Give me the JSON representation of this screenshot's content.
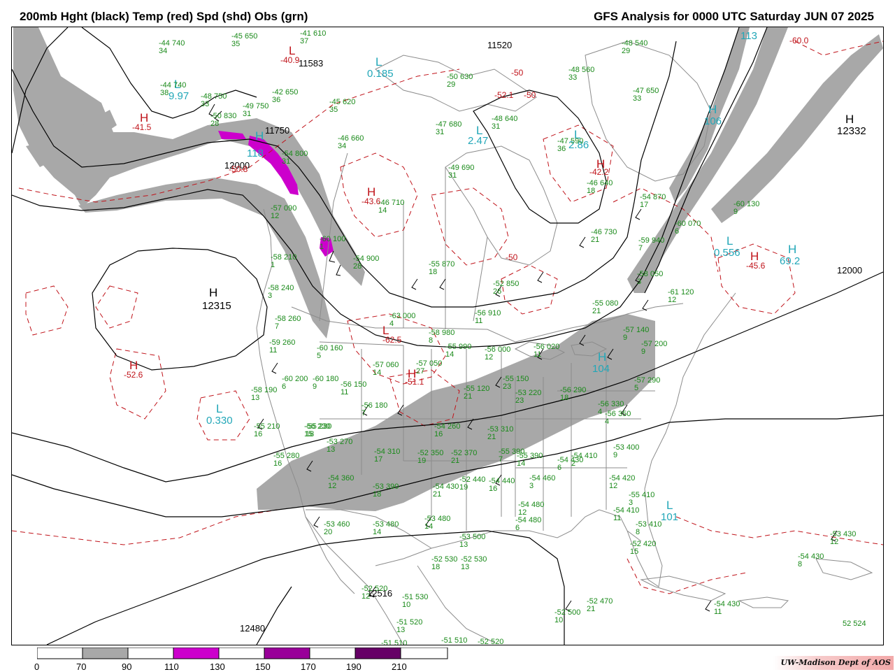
{
  "header": {
    "left_title": "200mb Hght (black) Temp (red) Spd (shd) Obs (grn)",
    "right_title": "GFS Analysis for 0000 UTC Saturday  JUN 07 2025"
  },
  "colors": {
    "height_contours": "#000000",
    "temperature_contours": "#c0131a",
    "speed_70_90": "#a8a8a8",
    "speed_110_130": "#cc00cc",
    "speed_150_170": "#990099",
    "speed_190_210": "#660066",
    "observations": "#1a8a1a",
    "low_high_speed_labels": "#22a7b8",
    "map_boundaries": "#8c8c8c"
  },
  "pressure_centers": [
    {
      "letter": "H",
      "value": "12315",
      "color": "black"
    },
    {
      "letter": "H",
      "value": "12332",
      "color": "black"
    },
    {
      "letter": "H",
      "value": "-41.5",
      "color": "red"
    },
    {
      "letter": "H",
      "value": "-43.6",
      "color": "red"
    },
    {
      "letter": "H",
      "value": "-42.2",
      "color": "red"
    },
    {
      "letter": "H",
      "value": "-52.6",
      "color": "red"
    },
    {
      "letter": "H",
      "value": "-51.1",
      "color": "red"
    },
    {
      "letter": "H",
      "value": "-45.6",
      "color": "red"
    },
    {
      "letter": "L",
      "value": "-62.5",
      "color": "red"
    },
    {
      "letter": "L",
      "value": "-40.9",
      "color": "red"
    },
    {
      "letter": "L",
      "value": "0.185",
      "color": "cyan"
    },
    {
      "letter": "L",
      "value": "2.47",
      "color": "cyan"
    },
    {
      "letter": "L",
      "value": "0.330",
      "color": "cyan"
    },
    {
      "letter": "L",
      "value": "0.556",
      "color": "cyan"
    },
    {
      "letter": "L",
      "value": "2.86",
      "color": "cyan"
    },
    {
      "letter": "L",
      "value": "9.97",
      "color": "cyan"
    },
    {
      "letter": "H",
      "value": "106",
      "color": "cyan"
    },
    {
      "letter": "H",
      "value": "69.2",
      "color": "cyan"
    },
    {
      "letter": "H",
      "value": "118",
      "color": "cyan"
    },
    {
      "letter": "H",
      "value": "104",
      "color": "cyan"
    },
    {
      "letter": "L",
      "value": "101",
      "color": "cyan"
    }
  ],
  "contour_labels": [
    "11520",
    "11583",
    "12000",
    "12000",
    "11750",
    "12516",
    "12480",
    "113",
    "-60.0",
    "-50",
    "-52.1",
    "-50",
    "-50",
    "-50.8"
  ],
  "observations": [
    {
      "top": "-44 740",
      "bottom": "34"
    },
    {
      "top": "-45 650",
      "bottom": "35"
    },
    {
      "top": "-41 610",
      "bottom": "37"
    },
    {
      "top": "-44 740",
      "bottom": "38"
    },
    {
      "top": "-48 750",
      "bottom": "33"
    },
    {
      "top": "-49 750",
      "bottom": "31"
    },
    {
      "top": "-50 830",
      "bottom": "28"
    },
    {
      "top": "-42 650",
      "bottom": "36"
    },
    {
      "top": "-45 620",
      "bottom": "35"
    },
    {
      "top": "-50 630",
      "bottom": "29"
    },
    {
      "top": "-48 560",
      "bottom": "33"
    },
    {
      "top": "-48 540",
      "bottom": "29"
    },
    {
      "top": "-47 650",
      "bottom": "33"
    },
    {
      "top": "-47 680",
      "bottom": "31"
    },
    {
      "top": "-48 640",
      "bottom": "31"
    },
    {
      "top": "-46 660",
      "bottom": "34"
    },
    {
      "top": "-47 590",
      "bottom": "36"
    },
    {
      "top": "-54 800",
      "bottom": "31"
    },
    {
      "top": "-49 690",
      "bottom": "31"
    },
    {
      "top": "-46 640",
      "bottom": "18"
    },
    {
      "top": "-46 710",
      "bottom": "14"
    },
    {
      "top": "-54 870",
      "bottom": "17"
    },
    {
      "top": "-60 130",
      "bottom": "9"
    },
    {
      "top": "-57 090",
      "bottom": "12"
    },
    {
      "top": "-60 070",
      "bottom": "6"
    },
    {
      "top": "-46 730",
      "bottom": "21"
    },
    {
      "top": "-60 100",
      "bottom": "1"
    },
    {
      "top": "-59 940",
      "bottom": "7"
    },
    {
      "top": "-58 210",
      "bottom": "1"
    },
    {
      "top": "-54 900",
      "bottom": "28"
    },
    {
      "top": "-55 870",
      "bottom": "18"
    },
    {
      "top": "-58 050",
      "bottom": "3"
    },
    {
      "top": "-52 850",
      "bottom": "26"
    },
    {
      "top": "-58 240",
      "bottom": "3"
    },
    {
      "top": "-61 120",
      "bottom": "12"
    },
    {
      "top": "-55 080",
      "bottom": "21"
    },
    {
      "top": "-56 910",
      "bottom": "11"
    },
    {
      "top": "-58 260",
      "bottom": "7"
    },
    {
      "top": "-63 000",
      "bottom": "4"
    },
    {
      "top": "-58 980",
      "bottom": "8"
    },
    {
      "top": "-59 260",
      "bottom": "11"
    },
    {
      "top": "-60 160",
      "bottom": "5"
    },
    {
      "top": "-55 990",
      "bottom": "14"
    },
    {
      "top": "-56 000",
      "bottom": "12"
    },
    {
      "top": "-56 020",
      "bottom": "11"
    },
    {
      "top": "-57 140",
      "bottom": "9"
    },
    {
      "top": "-57 200",
      "bottom": "9"
    },
    {
      "top": "-57 060",
      "bottom": "14"
    },
    {
      "top": "-57 050",
      "bottom": "27"
    },
    {
      "top": "-60 200",
      "bottom": "6"
    },
    {
      "top": "-60 180",
      "bottom": "9"
    },
    {
      "top": "-56 150",
      "bottom": "11"
    },
    {
      "top": "-57 290",
      "bottom": "5"
    },
    {
      "top": "-58 190",
      "bottom": "13"
    },
    {
      "top": "-55 120",
      "bottom": "21"
    },
    {
      "top": "-55 150",
      "bottom": "23"
    },
    {
      "top": "-53 220",
      "bottom": "23"
    },
    {
      "top": "-56 290",
      "bottom": "18"
    },
    {
      "top": "-56 180",
      "bottom": "7"
    },
    {
      "top": "-55 230",
      "bottom": "18"
    },
    {
      "top": "-56 330",
      "bottom": "4"
    },
    {
      "top": "-55 210",
      "bottom": "16"
    },
    {
      "top": "-56 230",
      "bottom": "15"
    },
    {
      "top": "-54 260",
      "bottom": "16"
    },
    {
      "top": "-53 310",
      "bottom": "21"
    },
    {
      "top": "-56 350",
      "bottom": "4"
    },
    {
      "top": "-55 390",
      "bottom": "7"
    },
    {
      "top": "-53 270",
      "bottom": "13"
    },
    {
      "top": "-53 400",
      "bottom": "9"
    },
    {
      "top": "-55 280",
      "bottom": "16"
    },
    {
      "top": "-54 310",
      "bottom": "17"
    },
    {
      "top": "-52 350",
      "bottom": "19"
    },
    {
      "top": "-52 370",
      "bottom": "21"
    },
    {
      "top": "-55 390",
      "bottom": "14"
    },
    {
      "top": "-54 430",
      "bottom": "6"
    },
    {
      "top": "-54 410",
      "bottom": "2"
    },
    {
      "top": "-54 420",
      "bottom": "12"
    },
    {
      "top": "-54 360",
      "bottom": "12"
    },
    {
      "top": "-52 440",
      "bottom": "19"
    },
    {
      "top": "-54 440",
      "bottom": "16"
    },
    {
      "top": "-54 460",
      "bottom": "3"
    },
    {
      "top": "-53 390",
      "bottom": "18"
    },
    {
      "top": "-54 430",
      "bottom": "21"
    },
    {
      "top": "-54 480",
      "bottom": "12"
    },
    {
      "top": "-55 410",
      "bottom": "3"
    },
    {
      "top": "-54 480",
      "bottom": "6"
    },
    {
      "top": "-54 410",
      "bottom": "11"
    },
    {
      "top": "-53 410",
      "bottom": "8"
    },
    {
      "top": "-53 460",
      "bottom": "20"
    },
    {
      "top": "-53 480",
      "bottom": "14"
    },
    {
      "top": "-53 480",
      "bottom": "14"
    },
    {
      "top": "-53 500",
      "bottom": "13"
    },
    {
      "top": "-52 420",
      "bottom": "15"
    },
    {
      "top": "-53 430",
      "bottom": "12"
    },
    {
      "top": "-52 530",
      "bottom": "18"
    },
    {
      "top": "-52 530",
      "bottom": "13"
    },
    {
      "top": "-54 430",
      "bottom": "8"
    },
    {
      "top": "-52 520",
      "bottom": "12"
    },
    {
      "top": "-51 530",
      "bottom": "10"
    },
    {
      "top": "-52 500",
      "bottom": "10"
    },
    {
      "top": "-52 470",
      "bottom": "21"
    },
    {
      "top": "-54 430",
      "bottom": "11"
    },
    {
      "top": "-51 520",
      "bottom": "13"
    },
    {
      "top": "-51 510",
      "bottom": ""
    },
    {
      "top": "-51 510",
      "bottom": ""
    },
    {
      "top": "-52 520",
      "bottom": ""
    },
    {
      "top": "52 524",
      "bottom": ""
    }
  ],
  "legend": {
    "ticks": [
      "0",
      "70",
      "90",
      "110",
      "130",
      "150",
      "170",
      "190",
      "210"
    ]
  },
  "credit": "UW-Madison   Dept of AOS"
}
